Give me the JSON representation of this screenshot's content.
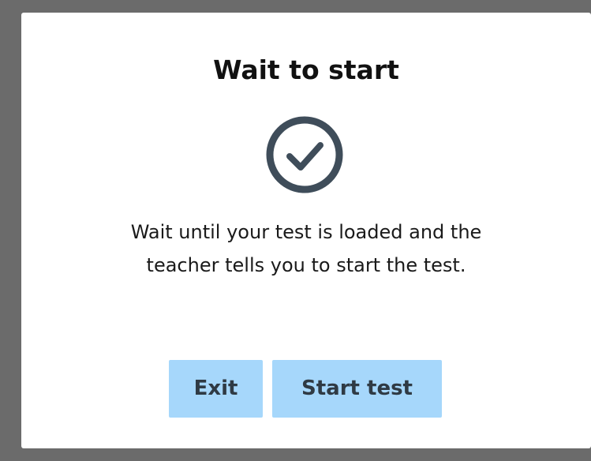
{
  "dialog": {
    "title": "Wait to start",
    "icon": "check-circle-icon",
    "message_line_1": "Wait until your test is loaded and the",
    "message_line_2": "teacher tells you to start the test.",
    "buttons": {
      "exit_label": "Exit",
      "start_label": "Start test"
    },
    "colors": {
      "background": "#ffffff",
      "backdrop": "#6b6b6b",
      "button": "#a6d7fb",
      "icon": "#3f4d5a"
    }
  }
}
